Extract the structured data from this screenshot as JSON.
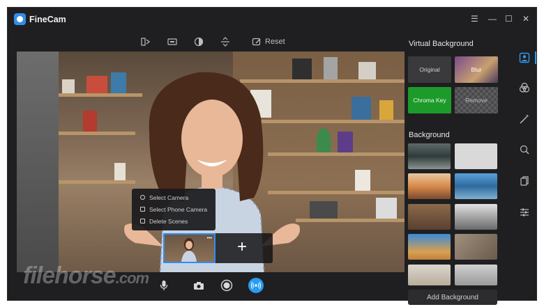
{
  "app": {
    "title": "FineCam"
  },
  "window_controls": {
    "menu": "☰",
    "minimize": "—",
    "maximize": "☐",
    "close": "✕"
  },
  "toolbar": {
    "reset_label": "Reset"
  },
  "context_menu": {
    "items": [
      {
        "label": "Select Camera"
      },
      {
        "label": "Select Phone Camera"
      },
      {
        "label": "Delete Scenes"
      }
    ]
  },
  "scenes": {
    "add_label": "+",
    "more": "•••"
  },
  "watermark": {
    "main": "filehorse",
    "suffix": ".com"
  },
  "virtual_background": {
    "title": "Virtual Background",
    "options": [
      {
        "label": "Original"
      },
      {
        "label": "Blur"
      },
      {
        "label": "Chroma Key"
      },
      {
        "label": "Remove"
      }
    ]
  },
  "background": {
    "title": "Background",
    "add_label": "Add Background"
  },
  "colors": {
    "accent": "#2a9bf0",
    "chroma": "#1c9b2a",
    "panel": "#1f1f21"
  }
}
